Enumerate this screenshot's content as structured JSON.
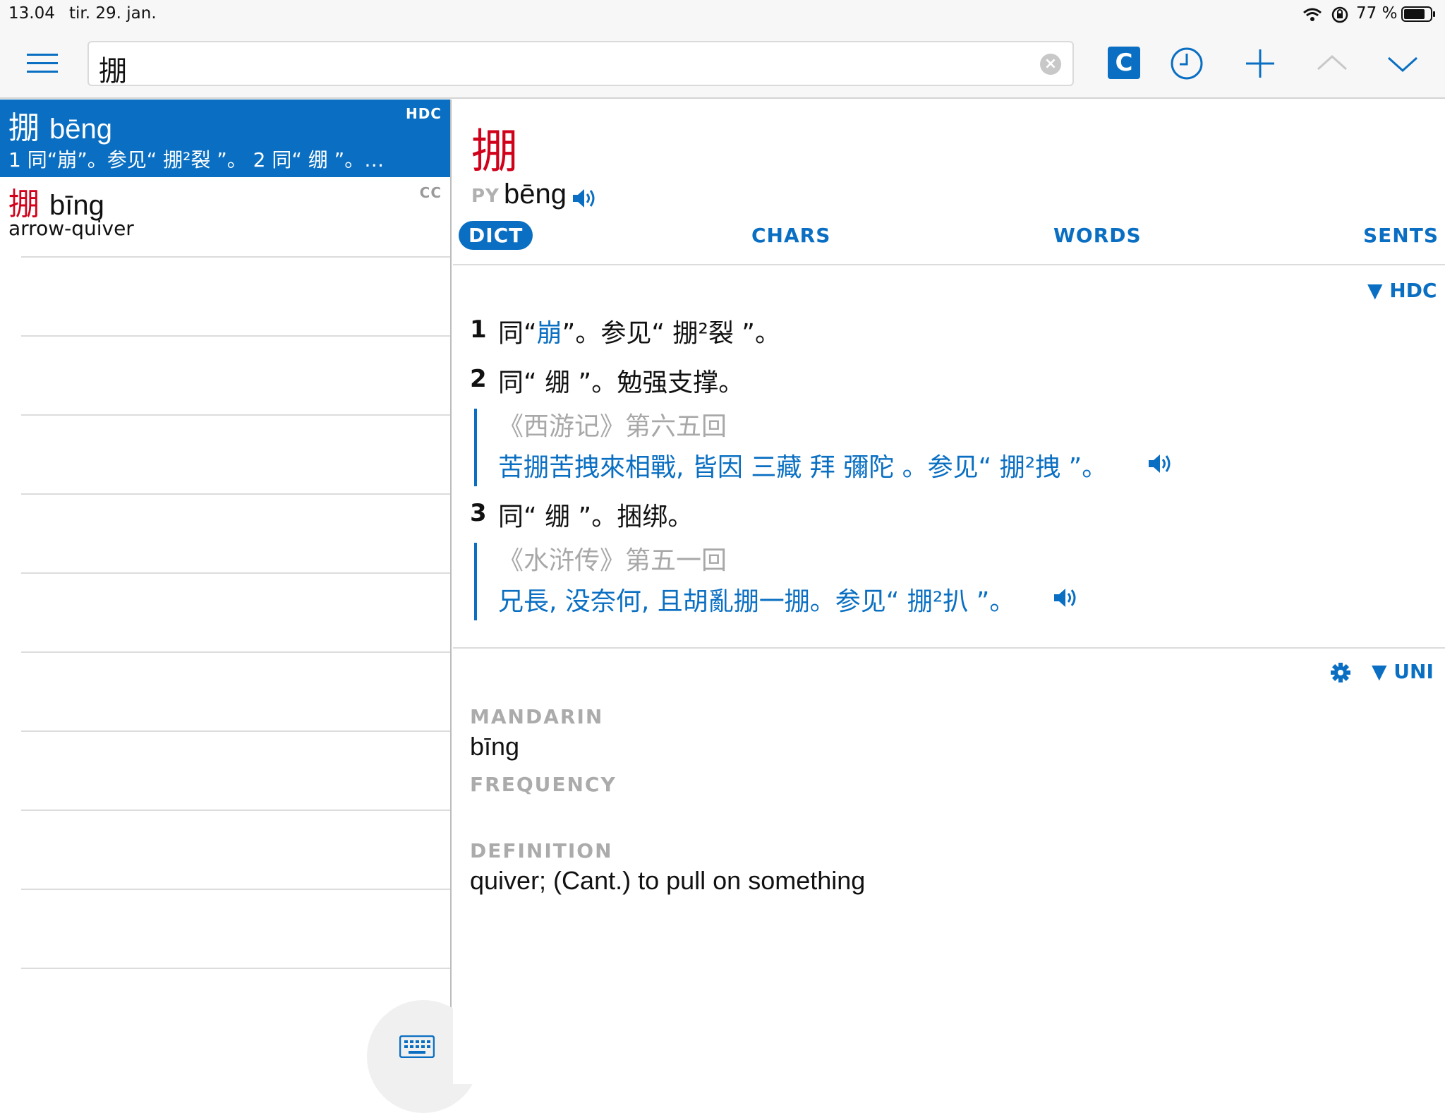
{
  "status": {
    "time": "13.04",
    "date": "tir. 29. jan.",
    "battery": "77 %"
  },
  "search": {
    "value": "掤"
  },
  "toolbar": {
    "mode_label": "C"
  },
  "results": [
    {
      "char": "掤",
      "pinyin": "bēng",
      "source": "HDC",
      "gloss": "1 同“崩”。参见“ 掤²裂 ”。  2 同“ 绷 ”。…"
    },
    {
      "char": "掤",
      "pinyin": "bīng",
      "source": "CC",
      "gloss": "arrow-quiver"
    }
  ],
  "entry": {
    "char": "掤",
    "py_label": "PY",
    "pinyin": "bēng",
    "tabs": [
      "DICT",
      "CHARS",
      "WORDS",
      "SENTS"
    ],
    "hdc_header": "▼ HDC",
    "def1_num": "1",
    "def1_a": "同“",
    "def1_link": "崩",
    "def1_b": "”。参见“ 掤²裂 ”。",
    "def2_num": "2",
    "def2": "同“ 绷 ”。勉强支撑。",
    "cite2": "《西游记》第六五回",
    "ex2": "苦掤苦拽來相戰, 皆因 三藏 拜 彌陀 。参见“ 掤²拽 ”。",
    "def3_num": "3",
    "def3": "同“ 绷 ”。捆绑。",
    "cite3": "《水浒传》第五一回",
    "ex3": "兄長, 没奈何, 且胡亂掤一掤。参见“ 掤²扒 ”。",
    "uni_header": "▼ UNI",
    "mandarin_label": "MANDARIN",
    "mandarin": "bīng",
    "frequency_label": "FREQUENCY",
    "definition_label": "DEFINITION",
    "definition": "quiver; (Cant.) to pull on something"
  },
  "colors": {
    "accent": "#0a6fc2",
    "headword": "#d0021b"
  }
}
